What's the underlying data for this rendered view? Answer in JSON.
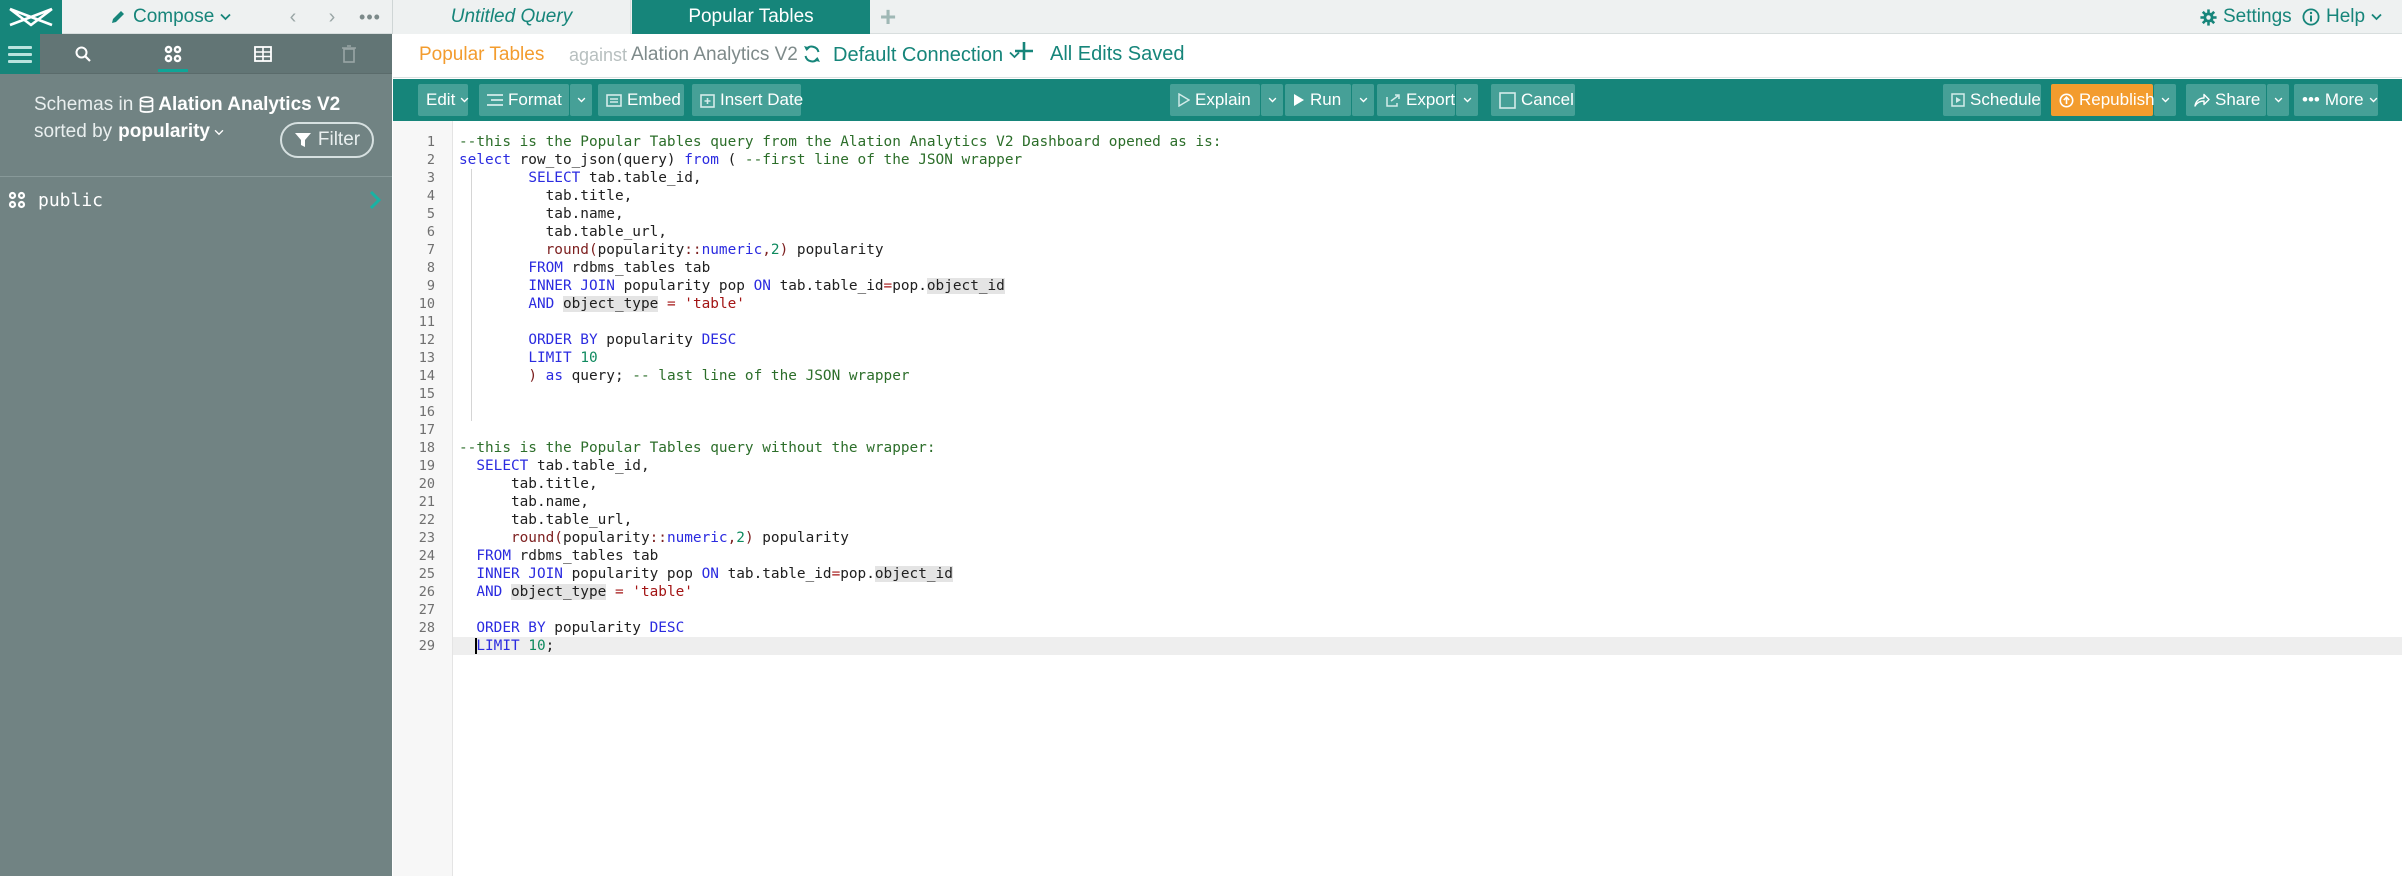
{
  "topbar": {
    "compose_label": "Compose",
    "tabs": [
      {
        "label": "Untitled Query"
      },
      {
        "label": "Popular Tables"
      }
    ],
    "settings_label": "Settings",
    "help_label": "Help"
  },
  "sidebar": {
    "schemas_prefix": "Schemas in",
    "db_name": "Alation Analytics V2",
    "sorted_by_prefix": "sorted by",
    "sort_value": "popularity",
    "filter_label": "Filter",
    "schemas": [
      {
        "name": "public"
      }
    ]
  },
  "query_header": {
    "title": "Popular Tables",
    "against": "against",
    "datasource": "Alation Analytics V2",
    "connection": "Default Connection",
    "save_status": "All Edits Saved"
  },
  "toolbar": {
    "edit": "Edit",
    "format": "Format",
    "embed": "Embed",
    "insert_date": "Insert Date",
    "explain": "Explain",
    "run": "Run",
    "export": "Export",
    "cancel": "Cancel",
    "schedule": "Schedule",
    "republish": "Republish",
    "share": "Share",
    "more": "More"
  },
  "colors": {
    "brand": "#16857a",
    "accent": "#f39c2e",
    "sidebar": "#718383"
  },
  "editor": {
    "lines": [
      {
        "n": "1",
        "segs": [
          [
            "com",
            "--this is the Popular Tables query from the Alation Analytics V2 Dashboard opened as is:"
          ]
        ]
      },
      {
        "n": "2",
        "segs": [
          [
            "kw",
            "select"
          ],
          [
            "",
            " row_to_json(query) "
          ],
          [
            "kw",
            "from"
          ],
          [
            "",
            " ( "
          ],
          [
            "com",
            "--first line of the JSON wrapper"
          ]
        ]
      },
      {
        "n": "3",
        "segs": [
          [
            "",
            "        "
          ],
          [
            "kw",
            "SELECT"
          ],
          [
            "",
            " tab.table_id,"
          ]
        ]
      },
      {
        "n": "4",
        "segs": [
          [
            "",
            "          tab.title,"
          ]
        ]
      },
      {
        "n": "5",
        "segs": [
          [
            "",
            "          tab.name,"
          ]
        ]
      },
      {
        "n": "6",
        "segs": [
          [
            "",
            "          tab.table_url,"
          ]
        ]
      },
      {
        "n": "7",
        "segs": [
          [
            "",
            "          "
          ],
          [
            "fn",
            "round("
          ],
          [
            "",
            "popularity"
          ],
          [
            "fn",
            "::"
          ],
          [
            "kw",
            "numeric"
          ],
          [
            "fn",
            ","
          ],
          [
            "num",
            "2"
          ],
          [
            "fn",
            ")"
          ],
          [
            "",
            " popularity"
          ]
        ]
      },
      {
        "n": "8",
        "segs": [
          [
            "",
            "        "
          ],
          [
            "kw",
            "FROM"
          ],
          [
            "",
            " rdbms_tables tab"
          ]
        ]
      },
      {
        "n": "9",
        "segs": [
          [
            "",
            "        "
          ],
          [
            "kw",
            "INNER JOIN"
          ],
          [
            "",
            " popularity pop "
          ],
          [
            "kw",
            "ON"
          ],
          [
            "",
            " tab.table_id"
          ],
          [
            "str",
            "="
          ],
          [
            "",
            "pop."
          ],
          [
            "hl",
            "object_id"
          ]
        ]
      },
      {
        "n": "10",
        "segs": [
          [
            "",
            "        "
          ],
          [
            "kw",
            "AND"
          ],
          [
            "",
            " "
          ],
          [
            "hl",
            "object_type"
          ],
          [
            "",
            " "
          ],
          [
            "str",
            "= 'table'"
          ]
        ]
      },
      {
        "n": "11",
        "segs": [
          [
            "",
            ""
          ]
        ]
      },
      {
        "n": "12",
        "segs": [
          [
            "",
            "        "
          ],
          [
            "kw",
            "ORDER BY"
          ],
          [
            "",
            " popularity "
          ],
          [
            "kw",
            "DESC"
          ]
        ]
      },
      {
        "n": "13",
        "segs": [
          [
            "",
            "        "
          ],
          [
            "kw",
            "LIMIT"
          ],
          [
            "",
            " "
          ],
          [
            "num",
            "10"
          ]
        ]
      },
      {
        "n": "14",
        "segs": [
          [
            "",
            "        "
          ],
          [
            "fn",
            ")"
          ],
          [
            "",
            " "
          ],
          [
            "kw",
            "as"
          ],
          [
            "",
            " query; "
          ],
          [
            "com",
            "-- last line of the JSON wrapper"
          ]
        ]
      },
      {
        "n": "15",
        "segs": [
          [
            "",
            ""
          ]
        ]
      },
      {
        "n": "16",
        "segs": [
          [
            "",
            ""
          ]
        ]
      },
      {
        "n": "17",
        "segs": [
          [
            "",
            ""
          ]
        ]
      },
      {
        "n": "18",
        "segs": [
          [
            "com",
            "--this is the Popular Tables query without the wrapper:"
          ]
        ]
      },
      {
        "n": "19",
        "segs": [
          [
            "",
            "  "
          ],
          [
            "kw",
            "SELECT"
          ],
          [
            "",
            " tab.table_id,"
          ]
        ]
      },
      {
        "n": "20",
        "segs": [
          [
            "",
            "      tab.title,"
          ]
        ]
      },
      {
        "n": "21",
        "segs": [
          [
            "",
            "      tab.name,"
          ]
        ]
      },
      {
        "n": "22",
        "segs": [
          [
            "",
            "      tab.table_url,"
          ]
        ]
      },
      {
        "n": "23",
        "segs": [
          [
            "",
            "      "
          ],
          [
            "fn",
            "round("
          ],
          [
            "",
            "popularity"
          ],
          [
            "fn",
            "::"
          ],
          [
            "kw",
            "numeric"
          ],
          [
            "fn",
            ","
          ],
          [
            "num",
            "2"
          ],
          [
            "fn",
            ")"
          ],
          [
            "",
            " popularity"
          ]
        ]
      },
      {
        "n": "24",
        "segs": [
          [
            "",
            "  "
          ],
          [
            "kw",
            "FROM"
          ],
          [
            "",
            " rdbms_tables tab"
          ]
        ]
      },
      {
        "n": "25",
        "segs": [
          [
            "",
            "  "
          ],
          [
            "kw",
            "INNER JOIN"
          ],
          [
            "",
            " popularity pop "
          ],
          [
            "kw",
            "ON"
          ],
          [
            "",
            " tab.table_id"
          ],
          [
            "str",
            "="
          ],
          [
            "",
            "pop."
          ],
          [
            "hl",
            "object_id"
          ]
        ]
      },
      {
        "n": "26",
        "segs": [
          [
            "",
            "  "
          ],
          [
            "kw",
            "AND"
          ],
          [
            "",
            " "
          ],
          [
            "hl",
            "object_type"
          ],
          [
            "",
            " "
          ],
          [
            "str",
            "= 'table'"
          ]
        ]
      },
      {
        "n": "27",
        "segs": [
          [
            "",
            ""
          ]
        ]
      },
      {
        "n": "28",
        "segs": [
          [
            "",
            "  "
          ],
          [
            "kw",
            "ORDER BY"
          ],
          [
            "",
            " popularity "
          ],
          [
            "kw",
            "DESC"
          ]
        ]
      },
      {
        "n": "29",
        "segs": [
          [
            "",
            "  "
          ],
          [
            "kw",
            "LIMIT"
          ],
          [
            "",
            " "
          ],
          [
            "num",
            "10"
          ],
          [
            "",
            ";"
          ]
        ]
      }
    ]
  }
}
